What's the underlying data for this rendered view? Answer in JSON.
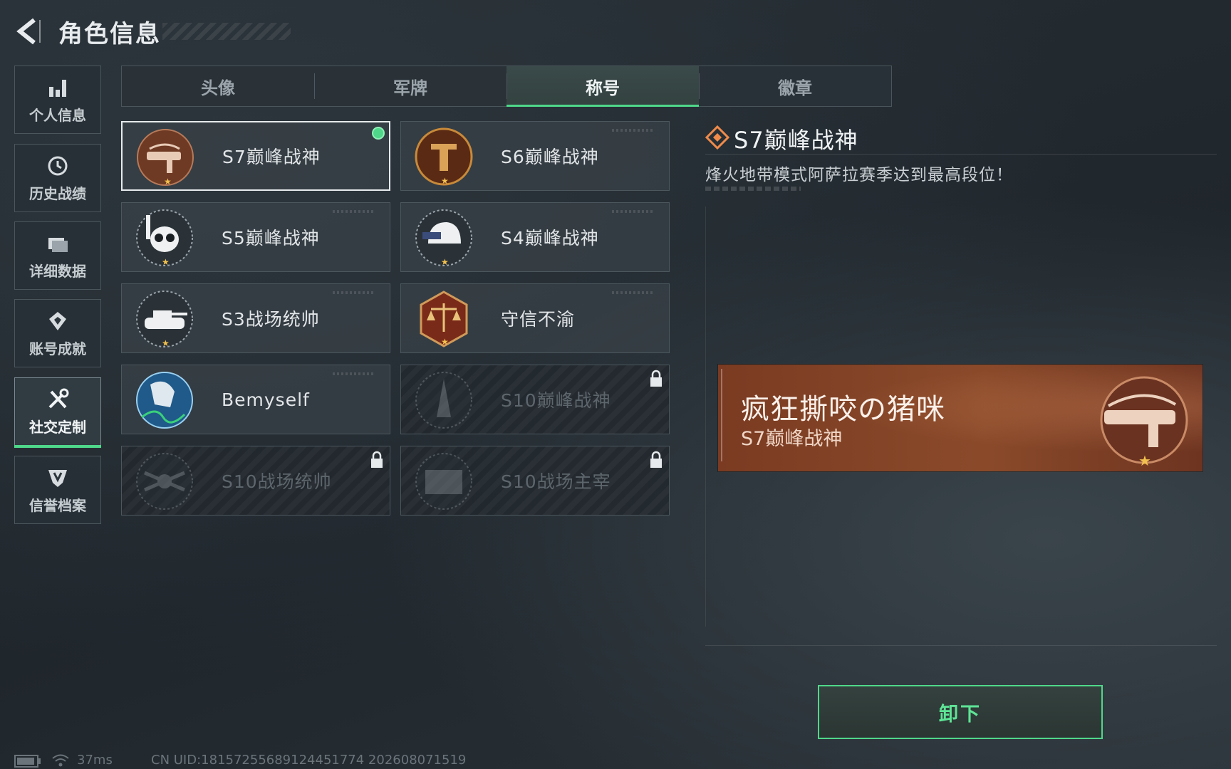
{
  "header": {
    "title": "角色信息"
  },
  "sidebar": {
    "items": [
      {
        "label": "个人信息",
        "icon": "bar-chart-icon"
      },
      {
        "label": "历史战绩",
        "icon": "clock-icon"
      },
      {
        "label": "详细数据",
        "icon": "folder-icon"
      },
      {
        "label": "账号成就",
        "icon": "medal-icon"
      },
      {
        "label": "社交定制",
        "icon": "tools-icon",
        "active": true
      },
      {
        "label": "信誉档案",
        "icon": "shield-icon"
      }
    ]
  },
  "tabs": [
    {
      "label": "头像"
    },
    {
      "label": "军牌"
    },
    {
      "label": "称号",
      "active": true
    },
    {
      "label": "徽章"
    }
  ],
  "titles": [
    {
      "label": "S7巅峰战神",
      "state": "selected-equipped",
      "emblem": "gun-emblem-icon",
      "color": "#8a4a2e"
    },
    {
      "label": "S6巅峰战神",
      "state": "unlocked",
      "emblem": "shield-t-emblem-icon",
      "color": "#7a3a1e"
    },
    {
      "label": "S5巅峰战神",
      "state": "unlocked",
      "emblem": "skull-mask-emblem-icon",
      "color": "#3a4450"
    },
    {
      "label": "S4巅峰战神",
      "state": "unlocked",
      "emblem": "helmet-emblem-icon",
      "color": "#3a4450"
    },
    {
      "label": "S3战场统帅",
      "state": "unlocked",
      "emblem": "tank-emblem-icon",
      "color": "#3a4450"
    },
    {
      "label": "守信不渝",
      "state": "unlocked",
      "emblem": "scales-emblem-icon",
      "color": "#8a2e1e"
    },
    {
      "label": "Bemyself",
      "state": "unlocked",
      "emblem": "soldier-signature-emblem-icon",
      "color": "#2a6a9a"
    },
    {
      "label": "S10巅峰战神",
      "state": "locked",
      "emblem": "tower-emblem-icon",
      "color": "#3a4450"
    },
    {
      "label": "S10战场统帅",
      "state": "locked",
      "emblem": "drone-emblem-icon",
      "color": "#3a4450"
    },
    {
      "label": "S10战场主宰",
      "state": "locked",
      "emblem": "colosseum-emblem-icon",
      "color": "#3a4450"
    }
  ],
  "detail": {
    "title": "S7巅峰战神",
    "description": "烽火地带模式阿萨拉赛季达到最高段位！"
  },
  "nameplate": {
    "player_name": "疯狂撕咬の猪咪",
    "title": "S7巅峰战神",
    "background_color": "#7a3b22"
  },
  "actions": {
    "unequip_label": "卸下"
  },
  "footer": {
    "ping": "37ms",
    "uid": "CN UID:1815725568912445​1774 202608071519"
  },
  "colors": {
    "accent": "#4fd88a",
    "bg": "#252d33"
  }
}
